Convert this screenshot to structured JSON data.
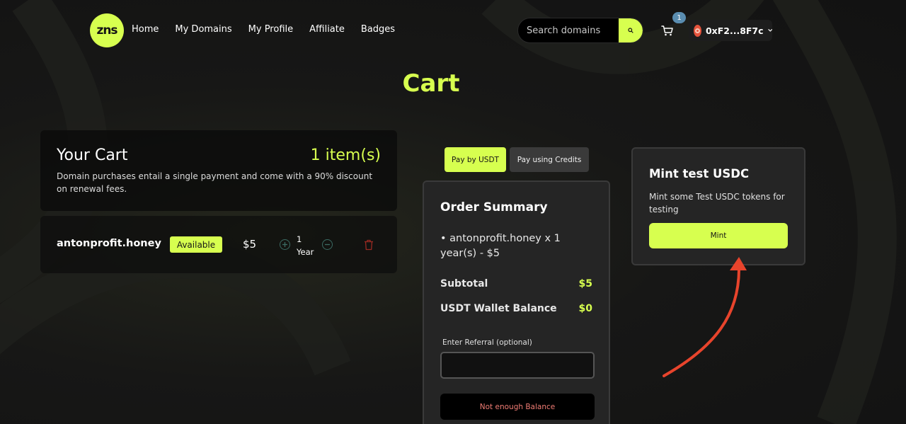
{
  "header": {
    "logo_text": "zns",
    "nav": [
      "Home",
      "My Domains",
      "My Profile",
      "Affiliate",
      "Badges"
    ],
    "search_placeholder": "Search domains",
    "cart_count": "1",
    "wallet_address": "0xF2...8F7c"
  },
  "page_title": "Cart",
  "cart": {
    "heading": "Your Cart",
    "count": "1 item(s)",
    "description": "Domain purchases entail a single payment and come with a 90% discount on renewal fees.",
    "item": {
      "name": "antonprofit.honey",
      "status": "Available",
      "price": "$5",
      "duration_value": "1",
      "duration_unit": "Year"
    }
  },
  "payment_tabs": {
    "usdt": "Pay by USDT",
    "credits": "Pay using Credits"
  },
  "order_summary": {
    "title": "Order Summary",
    "line_item": "• antonprofit.honey x 1 year(s) - $5",
    "subtotal_label": "Subtotal",
    "subtotal_value": "$5",
    "balance_label": "USDT Wallet Balance",
    "balance_value": "$0",
    "referral_label": "Enter Referral (optional)",
    "submit_label": "Not enough Balance"
  },
  "mint": {
    "title": "Mint test USDC",
    "description": "Mint some Test USDC tokens for testing",
    "button": "Mint"
  },
  "colors": {
    "accent": "#d7ff4f",
    "annotation_arrow": "#e8442c",
    "error_text": "#f07c74"
  }
}
